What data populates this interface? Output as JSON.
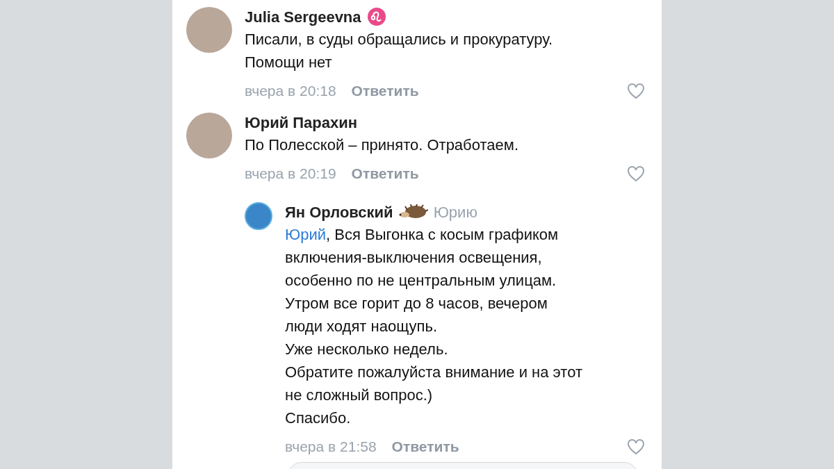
{
  "comments": [
    {
      "kind": "zodiac",
      "author": "Julia Sergeevna",
      "text": "Писали, в суды обращались и прокуратуру.\nПомощи нет",
      "time": "вчера в 20:18",
      "reply": "Ответить",
      "liked": false,
      "nested": false
    },
    {
      "kind": "plain",
      "author": "Юрий Парахин",
      "text": "По Полесской – принято. Отработаем.",
      "time": "вчера в 20:19",
      "reply": "Ответить",
      "liked": false,
      "nested": false
    },
    {
      "kind": "hedgehog",
      "author": "Ян Орловский",
      "reply_to": "Юрию",
      "mention": "Юрий",
      "text": ", Вся Выгонка с косым графиком\nвключения-выключения освещения,\nособенно по не центральным улицам.\nУтром все горит до 8 часов, вечером\nлюди ходят наощупь.\nУже несколько недель.\nОбратите пожалуйста внимание и на этот\nне сложный вопрос.)\nСпасибо.",
      "time": "вчера в 21:58",
      "reply": "Ответить",
      "liked": false,
      "nested": true
    }
  ]
}
